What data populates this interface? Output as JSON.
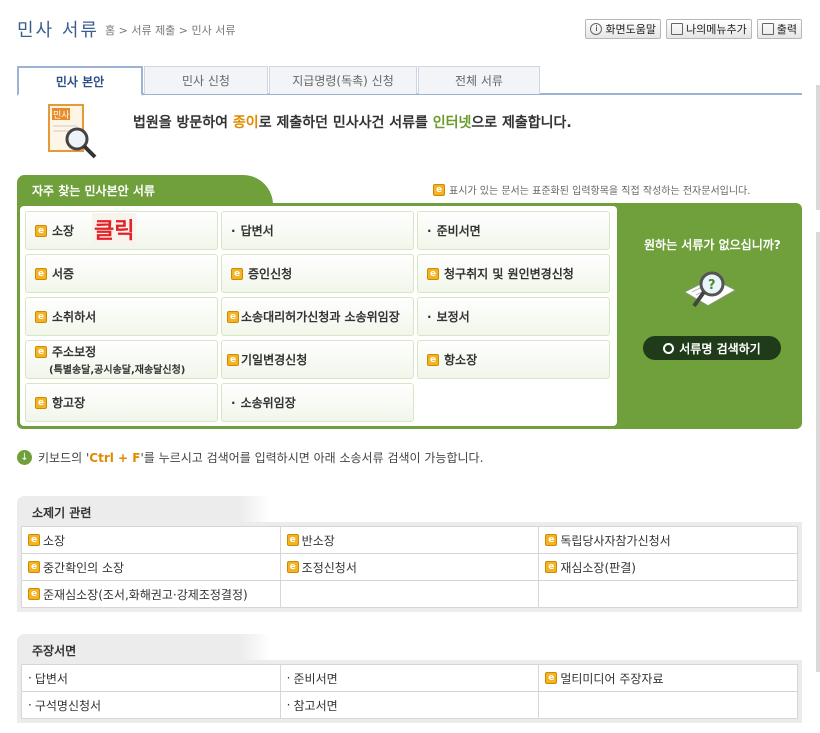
{
  "header": {
    "title": "민사 서류",
    "breadcrumb": "홈 > 서류 제출 > 민사 서류",
    "buttons": {
      "help": "화면도움말",
      "my_menu": "나의메뉴추가",
      "print": "출력"
    }
  },
  "tabs": [
    {
      "label": "민사 본안",
      "active": true
    },
    {
      "label": "민사 신청",
      "active": false
    },
    {
      "label": "지급명령(독촉) 신청",
      "active": false
    },
    {
      "label": "전체 서류",
      "active": false
    }
  ],
  "intro": {
    "part1": "법원을 방문하여 ",
    "paper": "종이",
    "part2": "로 제출하던 민사사건 서류를 ",
    "internet": "인터넷",
    "part3": "으로 제출합니다.",
    "icon_label": "민사"
  },
  "frequent": {
    "heading": "자주 찾는 민사본안 서류",
    "note": "표시가 있는 문서는 표준화된 입력항목을 직접 작성하는 전자문서입니다.",
    "click_label": "클릭",
    "items": [
      {
        "label": "소장",
        "icon": "e-doc-icon"
      },
      {
        "label": "답변서",
        "icon": "bullet"
      },
      {
        "label": "준비서면",
        "icon": "bullet"
      },
      {
        "label": "서증",
        "icon": "e-doc-icon"
      },
      {
        "label": "증인신청",
        "icon": "e-doc-icon"
      },
      {
        "label": "청구취지 및 원인변경신청",
        "icon": "e-doc-icon"
      },
      {
        "label": "소취하서",
        "icon": "e-doc-icon"
      },
      {
        "label": "소송대리허가신청과 소송위임장",
        "icon": "e-doc-icon"
      },
      {
        "label": "보정서",
        "icon": "bullet"
      },
      {
        "label": "주소보정",
        "sub": "(특별송달,공시송달,재송달신청)",
        "icon": "e-doc-icon"
      },
      {
        "label": "기일변경신청",
        "icon": "e-doc-icon"
      },
      {
        "label": "항소장",
        "icon": "e-doc-icon"
      },
      {
        "label": "항고장",
        "icon": "e-doc-icon"
      },
      {
        "label": "소송위임장",
        "icon": "bullet"
      }
    ],
    "side_question": "원하는 서류가 없으십니까?",
    "search_button": "서류명 검색하기"
  },
  "hint": {
    "before": "키보드의 '",
    "keys": "Ctrl + F",
    "after": "'를 누르시고 검색어를 입력하시면 아래 소송서류 검색이 가능합니다."
  },
  "sections": [
    {
      "heading": "소제기 관련",
      "rows": [
        [
          {
            "label": "소장",
            "icon": "e-doc-icon"
          },
          {
            "label": "반소장",
            "icon": "e-doc-icon"
          },
          {
            "label": "독립당사자참가신청서",
            "icon": "e-doc-icon"
          }
        ],
        [
          {
            "label": "중간확인의 소장",
            "icon": "e-doc-icon"
          },
          {
            "label": "조정신청서",
            "icon": "e-doc-icon"
          },
          {
            "label": "재심소장(판결)",
            "icon": "e-doc-icon"
          }
        ],
        [
          {
            "label": "준재심소장(조서,화해권고·강제조정결정)",
            "icon": "e-doc-icon"
          },
          {
            "label": ""
          },
          {
            "label": ""
          }
        ]
      ]
    },
    {
      "heading": "주장서면",
      "rows": [
        [
          {
            "label": "답변서",
            "icon": "bullet"
          },
          {
            "label": "준비서면",
            "icon": "bullet"
          },
          {
            "label": "멀티미디어 주장자료",
            "icon": "e-doc-icon"
          }
        ],
        [
          {
            "label": "구석명신청서",
            "icon": "bullet"
          },
          {
            "label": "참고서면",
            "icon": "bullet"
          },
          {
            "label": ""
          }
        ]
      ]
    }
  ],
  "colors": {
    "green": "#6fa03b",
    "title_blue": "#3b5f8f",
    "accent_red": "#e3232a",
    "accent_orange": "#e08a00"
  }
}
